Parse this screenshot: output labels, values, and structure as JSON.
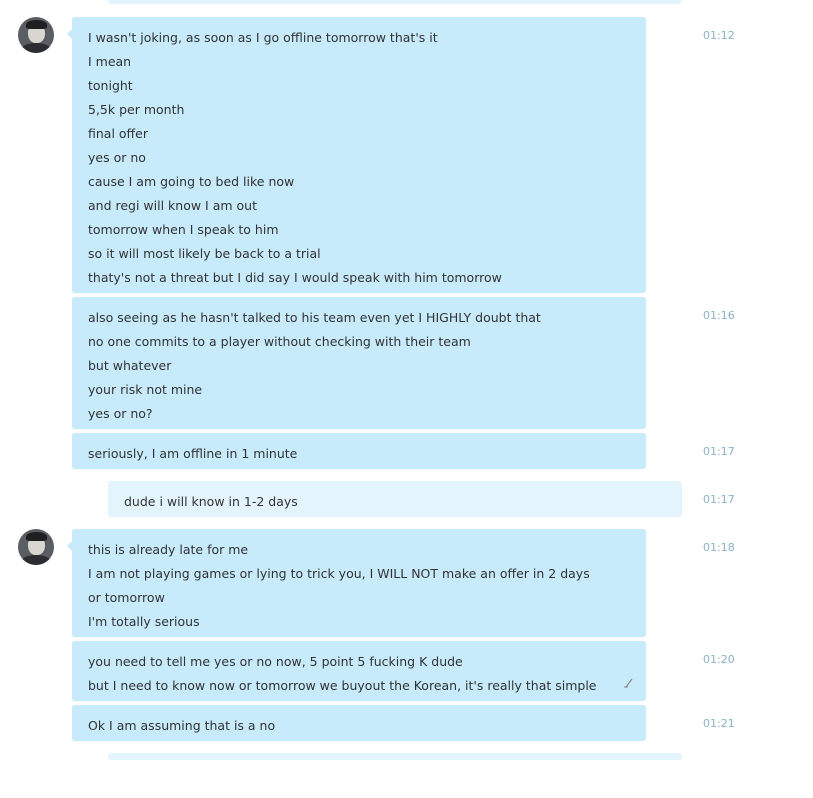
{
  "messages": [
    {
      "time": "01:12",
      "lines": [
        "I wasn't joking, as soon as I go offline tomorrow that's it",
        "I mean",
        "tonight",
        "5,5k per month",
        "final offer",
        "yes or no",
        "cause I am going to bed like now",
        "and regi will know I am out",
        "tomorrow when I speak to him",
        "so it will most likely be back to a trial",
        "thaty's not a threat but I did say I would speak with him tomorrow"
      ]
    },
    {
      "time": "01:16",
      "lines": [
        "also seeing as he hasn't talked to his team even yet I HIGHLY doubt that",
        "no one commits to a player without checking with their team",
        "but whatever",
        "your risk not mine",
        "yes or no?"
      ]
    },
    {
      "time": "01:17",
      "lines": [
        "seriously, I am offline in 1 minute"
      ]
    },
    {
      "time": "01:17",
      "lines": [
        "dude i will know in 1-2 days"
      ]
    },
    {
      "time": "01:18",
      "lines": [
        "this is already late for me",
        "I am not playing games or lying to trick you, I WILL NOT make an offer in 2 days",
        "or tomorrow",
        "I'm totally serious"
      ]
    },
    {
      "time": "01:20",
      "lines": [
        "you need to tell me yes or no now, 5 point 5 fucking K dude",
        "but I need to know now or tomorrow we buyout the Korean, it's really that simple"
      ],
      "edited_icon": "pencil-icon"
    },
    {
      "time": "01:21",
      "lines": [
        "Ok I am assuming that is a no"
      ]
    }
  ],
  "colors": {
    "incoming_bubble": "#c7ebfb",
    "outgoing_bubble": "#e4f4fc",
    "timestamp": "#8ab1c6",
    "text": "#333333"
  }
}
